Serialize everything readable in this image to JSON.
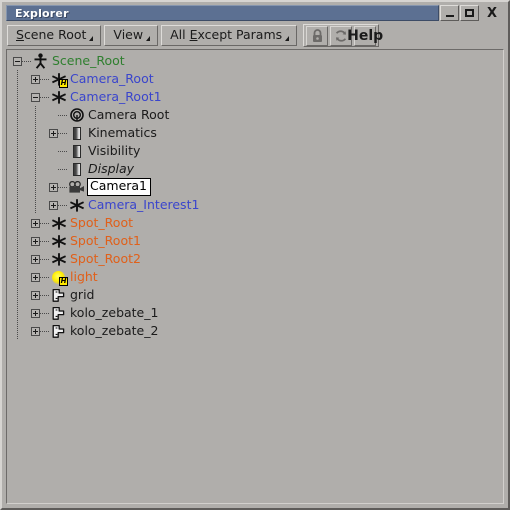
{
  "window": {
    "title": "Explorer",
    "controls": [
      {
        "name": "minimize-button",
        "glyph": "minimize"
      },
      {
        "name": "maximize-button",
        "glyph": "maximize"
      },
      {
        "name": "close-button",
        "glyph": "X"
      }
    ]
  },
  "toolbar": {
    "scope_label_pre": "S",
    "scope_label_post": "cene Root",
    "view_label": "View",
    "filter_label_pre": "All ",
    "filter_label_mnemonic": "E",
    "filter_label_post": "xcept Params",
    "icon_buttons": [
      {
        "name": "lock-icon",
        "title": "Lock"
      },
      {
        "name": "refresh-icon",
        "title": "Refresh"
      },
      {
        "name": "help-icon",
        "title": "Help"
      }
    ]
  },
  "colors": {
    "title_bar": "#5c7092",
    "panel_bg": "#b0aeab",
    "scene_root_text": "#2f7f2f",
    "camera_text": "#3a45cc",
    "spot_text": "#e0601a",
    "default_text": "#1b1b1b"
  },
  "tree": {
    "items": [
      {
        "name": "Scene_Root",
        "depth": 0,
        "toggle": "minus",
        "icon": "null-root-icon",
        "color": "#2f7f2f",
        "state": "normal"
      },
      {
        "name": "Camera_Root",
        "depth": 1,
        "toggle": "plus",
        "icon": "null-icon",
        "badge": "H",
        "color": "#3a45cc",
        "state": "normal"
      },
      {
        "name": "Camera_Root1",
        "depth": 1,
        "toggle": "minus",
        "icon": "null-icon",
        "color": "#3a45cc",
        "state": "normal"
      },
      {
        "name": "Camera Root",
        "depth": 2,
        "toggle": "none",
        "icon": "property-icon",
        "color": "#1b1b1b",
        "state": "normal"
      },
      {
        "name": "Kinematics",
        "depth": 2,
        "toggle": "plus",
        "icon": "gradient-icon",
        "color": "#1b1b1b",
        "state": "normal"
      },
      {
        "name": "Visibility",
        "depth": 2,
        "toggle": "none",
        "icon": "gradient-icon",
        "color": "#1b1b1b",
        "state": "normal"
      },
      {
        "name": "Display",
        "depth": 2,
        "toggle": "none",
        "icon": "gradient-icon",
        "color": "#1b1b1b",
        "state": "italic"
      },
      {
        "name": "Camera1",
        "depth": 2,
        "toggle": "plus",
        "icon": "camera-icon",
        "color": "#000000",
        "state": "editing"
      },
      {
        "name": "Camera_Interest1",
        "depth": 2,
        "toggle": "plus",
        "icon": "null-icon",
        "color": "#3a45cc",
        "state": "normal"
      },
      {
        "name": "Spot_Root",
        "depth": 1,
        "toggle": "plus",
        "icon": "null-icon",
        "color": "#e0601a",
        "state": "normal"
      },
      {
        "name": "Spot_Root1",
        "depth": 1,
        "toggle": "plus",
        "icon": "null-icon",
        "color": "#e0601a",
        "state": "normal"
      },
      {
        "name": "Spot_Root2",
        "depth": 1,
        "toggle": "plus",
        "icon": "null-icon",
        "color": "#e0601a",
        "state": "normal"
      },
      {
        "name": "light",
        "depth": 1,
        "toggle": "plus",
        "icon": "light-icon",
        "badge": "H",
        "color": "#e0601a",
        "state": "normal"
      },
      {
        "name": "grid",
        "depth": 1,
        "toggle": "plus",
        "icon": "mesh-icon",
        "color": "#1b1b1b",
        "state": "normal"
      },
      {
        "name": "kolo_zebate_1",
        "depth": 1,
        "toggle": "plus",
        "icon": "mesh-icon",
        "color": "#1b1b1b",
        "state": "normal"
      },
      {
        "name": "kolo_zebate_2",
        "depth": 1,
        "toggle": "plus",
        "icon": "mesh-icon",
        "color": "#1b1b1b",
        "state": "normal"
      }
    ]
  }
}
